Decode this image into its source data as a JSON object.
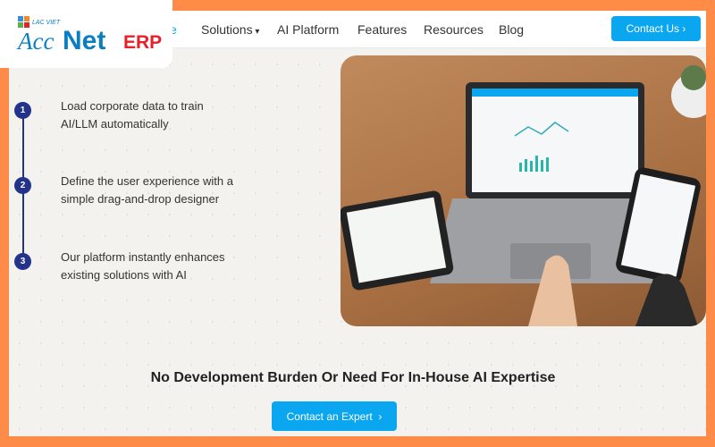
{
  "logo": {
    "brand": "LAC VIET",
    "name": "AccNet",
    "suffix": "ERP"
  },
  "nav": {
    "items": [
      "e",
      "Solutions",
      "AI Platform",
      "Features",
      "Resources",
      "Blog"
    ],
    "contact_label": "Contact Us",
    "contact_icon": "chevron-right"
  },
  "steps": [
    {
      "number": "1",
      "text": "Load corporate data to train AI/LLM automatically"
    },
    {
      "number": "2",
      "text": "Define the user experience with a simple drag-and-drop designer"
    },
    {
      "number": "3",
      "text": "Our platform instantly enhances existing solutions with AI"
    }
  ],
  "headline": "No Development Burden Or Need For In-House AI Expertise",
  "cta": {
    "label": "Contact an Expert",
    "icon": "chevron-right"
  },
  "colors": {
    "frame": "#fe8c48",
    "accent": "#0aa6ef",
    "step": "#23338a",
    "logo_blue": "#0b7ec2",
    "logo_red": "#e8202a"
  }
}
